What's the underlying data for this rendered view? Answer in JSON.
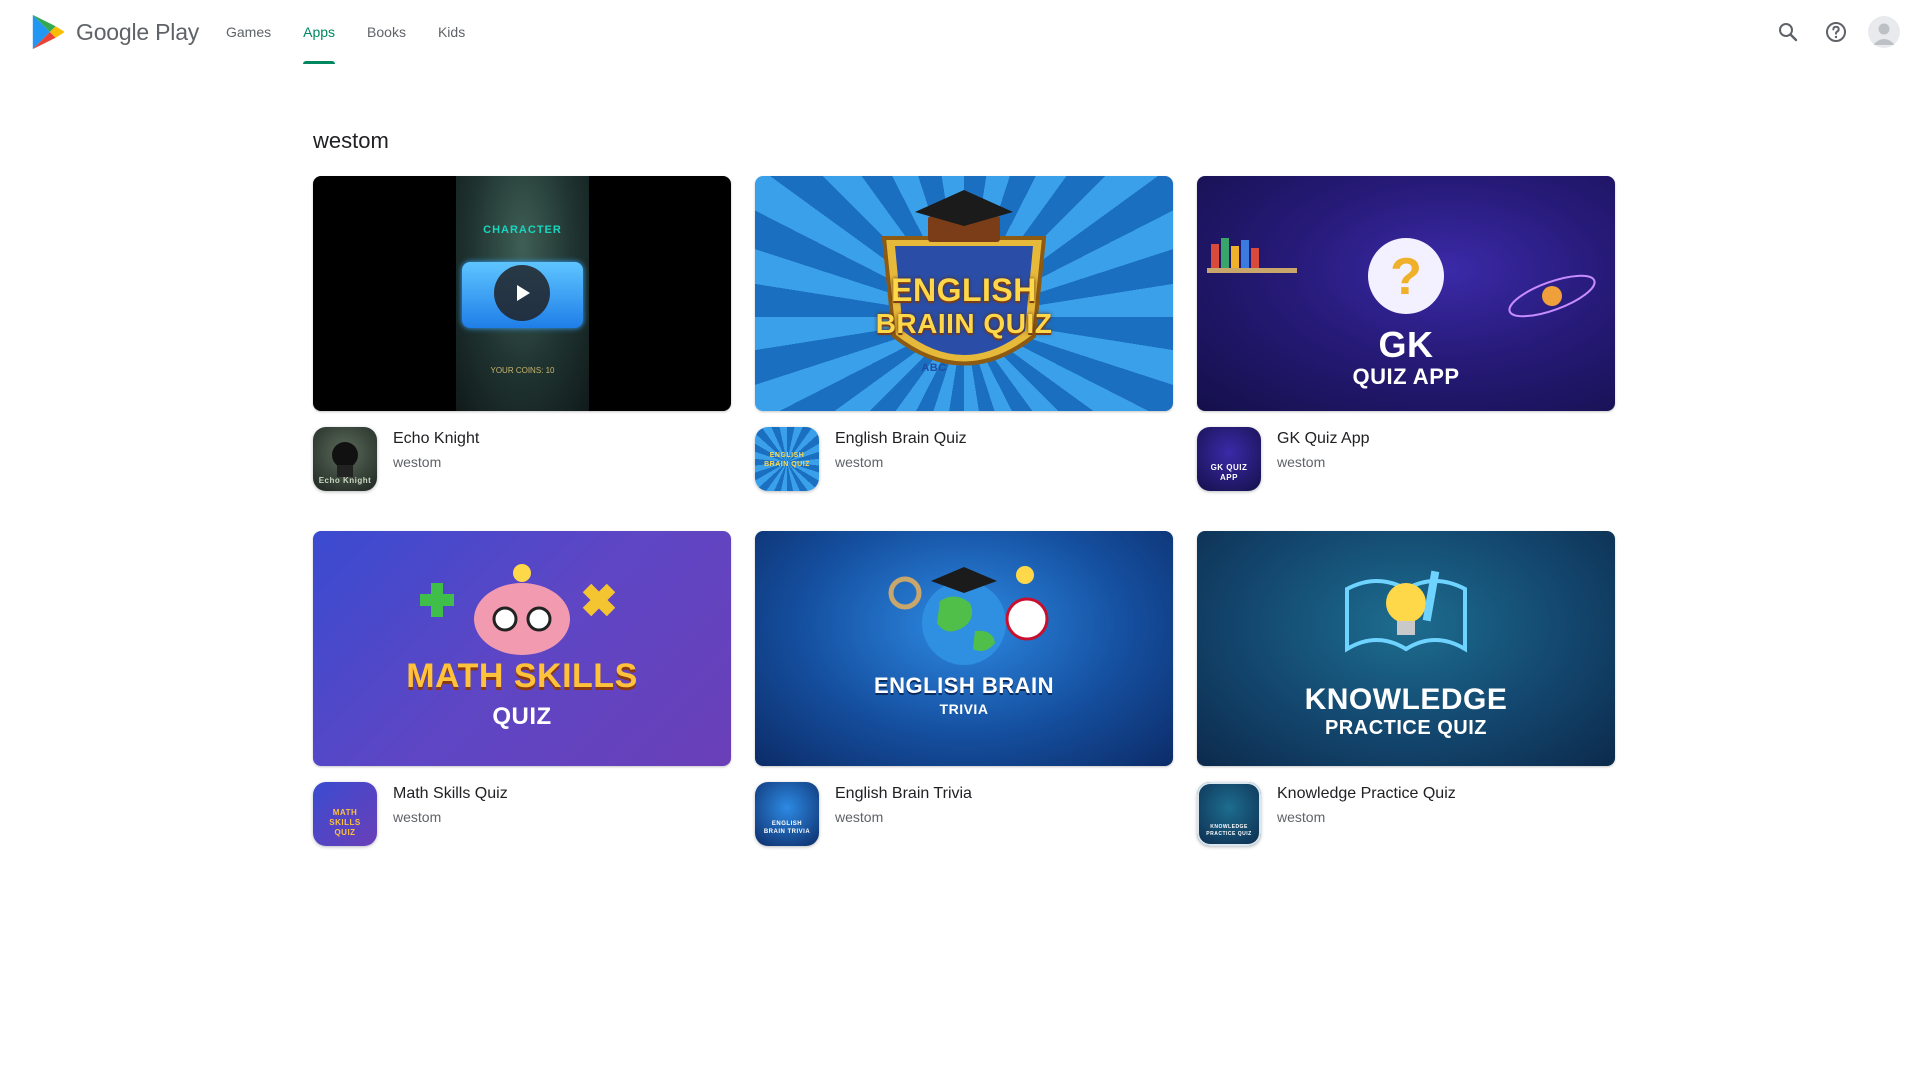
{
  "header": {
    "logo_text": "Google Play",
    "nav": [
      {
        "label": "Games",
        "active": false
      },
      {
        "label": "Apps",
        "active": true
      },
      {
        "label": "Books",
        "active": false
      },
      {
        "label": "Kids",
        "active": false
      }
    ],
    "icons": [
      "search-icon",
      "help-icon",
      "account-avatar-icon"
    ]
  },
  "page": {
    "title": "westom"
  },
  "apps": [
    {
      "name": "Echo Knight",
      "developer": "westom",
      "banner_text": [
        "CHARACTER",
        "YOUR COINS: 10"
      ],
      "icon_text": "Echo Knight",
      "has_video": true
    },
    {
      "name": "English Brain Quiz",
      "developer": "westom",
      "banner_text": [
        "ENGLISH",
        "BRAIIN QUIZ",
        "ABC"
      ],
      "icon_text": "ENGLISH BRAIN QUIZ"
    },
    {
      "name": "GK Quiz App",
      "developer": "westom",
      "banner_text": [
        "GK",
        "QUIZ APP"
      ],
      "icon_text": "GK QUIZ APP"
    },
    {
      "name": "Math Skills Quiz",
      "developer": "westom",
      "banner_text": [
        "MATH SKILLS",
        "QUIZ"
      ],
      "icon_text": "MATH SKILLS QUIZ"
    },
    {
      "name": "English Brain Trivia",
      "developer": "westom",
      "banner_text": [
        "ENGLISH BRAIN",
        "TRIVIA"
      ],
      "icon_text": "ENGLISH BRAIN TRIVIA"
    },
    {
      "name": "Knowledge Practice Quiz",
      "developer": "westom",
      "banner_text": [
        "KNOWLEDGE",
        "PRACTICE QUIZ"
      ],
      "icon_text": "KNOWLEDGE PRACTICE QUIZ"
    }
  ],
  "colors": {
    "accent": "#01875f",
    "text_primary": "#202124",
    "text_secondary": "#5f6368"
  }
}
